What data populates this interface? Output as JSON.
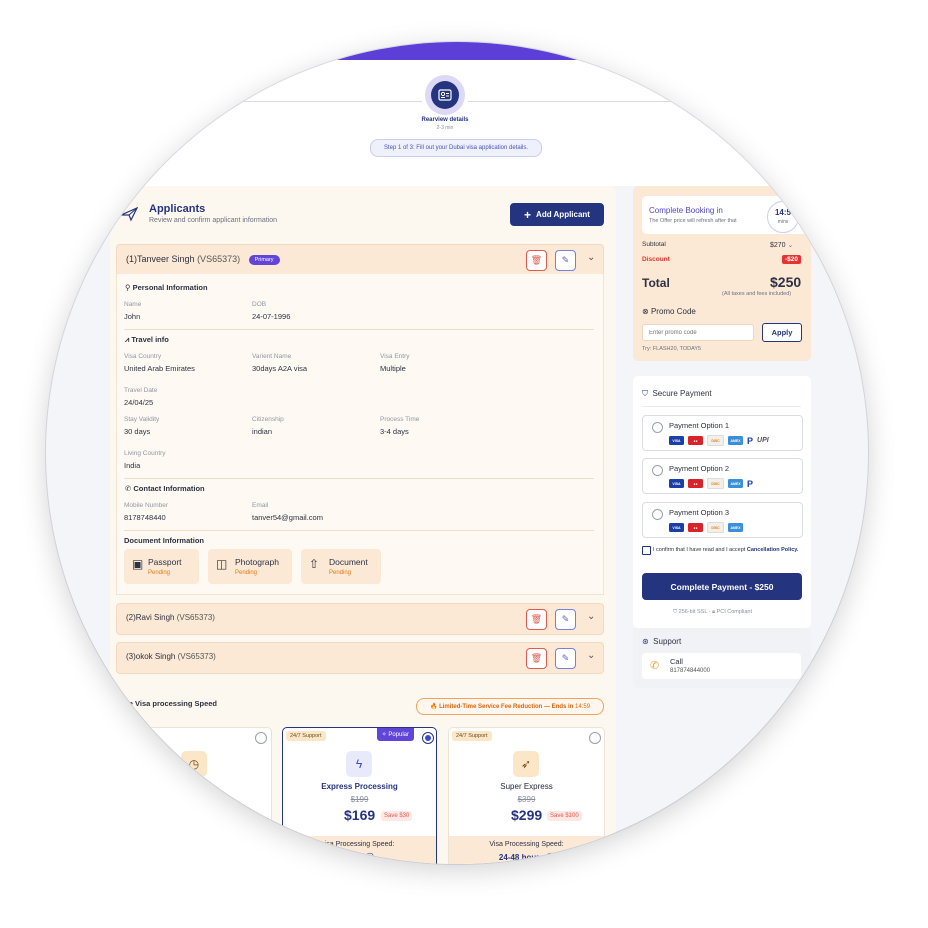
{
  "stepper": {
    "step_label": "Rearview details",
    "step_sub": "2-3 min",
    "hint": "Step 1 of 3: Fill out your Dubai visa application details."
  },
  "applicants": {
    "title": "Applicants",
    "subtitle": "Review and confirm applicant information",
    "add_label": "Add Applicant"
  },
  "applicant1": {
    "name": "(1)Tanveer Singh",
    "id": "(VS65373)",
    "badge": "Primary",
    "personal": {
      "title": "Personal Information",
      "name_label": "Name",
      "name": "John",
      "dob_label": "DOB",
      "dob": "24-07-1996"
    },
    "travel": {
      "title": "Travel info",
      "visa_country_label": "Visa Country",
      "visa_country": "United Arab Emirates",
      "variant_label": "Varient Name",
      "variant": "30days A2A visa",
      "entry_label": "Visa Entry",
      "entry": "Multiple",
      "travel_date_label": "Travel Date",
      "travel_date": "24/04/25",
      "stay_label": "Stay Validity",
      "stay": "30 days",
      "citizenship_label": "Citizenship",
      "citizenship": "indian",
      "process_label": "Process Time",
      "process": "3-4 days",
      "living_label": "Living Country",
      "living": "India"
    },
    "contact": {
      "title": "Contact Information",
      "mobile_label": "Mobile Number",
      "mobile": "8178748440",
      "email_label": "Email",
      "email": "tanver54@gmail.com"
    },
    "documents": {
      "title": "Document Information",
      "items": [
        {
          "name": "Passport",
          "status": "Pending"
        },
        {
          "name": "Photograph",
          "status": "Pending"
        },
        {
          "name": "Document",
          "status": "Pending"
        }
      ]
    }
  },
  "applicant2": {
    "name": "(2)Ravi Singh",
    "id": "(VS65373)"
  },
  "applicant3": {
    "name": "(3)okok Singh",
    "id": "(VS65373)"
  },
  "speed": {
    "title": "ose Visa processing Speed",
    "limited": "Limited-Time Service Fee Reduction — Ends in",
    "limited_time": "14:59",
    "cards": [
      {
        "tag": "",
        "name": "ssing",
        "old": "",
        "price": "",
        "save": "",
        "foot_label": "",
        "foot_value": ""
      },
      {
        "tag": "24/7 Support",
        "popular": "Popular",
        "name": "Express Processing",
        "old": "$199",
        "price": "$169",
        "save": "Save $30",
        "foot_label": "isa Processing Speed:",
        "foot_value": "days"
      },
      {
        "tag": "24/7 Support",
        "name": "Super Express",
        "old": "$399",
        "price": "$299",
        "save": "Save $100",
        "foot_label": "Visa Processing Speed:",
        "foot_value": "24-48 hours"
      }
    ]
  },
  "booking": {
    "title": "Complete Booking in",
    "sub": "The Offer price will refresh after that",
    "timer": "14:5",
    "timer_unit": "mins",
    "subtotal_label": "Subtotal",
    "subtotal": "$270",
    "discount_label": "Discount",
    "discount": "-$20",
    "total_label": "Total",
    "total": "$250",
    "total_note": "(All taxes and fees included)",
    "promo_label": "Promo Code",
    "promo_placeholder": "Enter promo code",
    "apply_label": "Apply",
    "promo_hint": "Try: FLASH20, TODAY5"
  },
  "payment": {
    "title": "Secure Payment",
    "options": [
      "Payment Option 1",
      "Payment Option 2",
      "Payment Option 3"
    ],
    "consent": "I confirm that I have read and I accept",
    "consent_link": "Cancellation Policy.",
    "complete_label": "Complete Payment - $250",
    "ssl": "256-bit SSL",
    "pci": "PCI Compliant",
    "upi": "UPI"
  },
  "support": {
    "title": "Support",
    "call_label": "Call",
    "call_number": "817874844000"
  },
  "colors": {
    "primary": "#25347f",
    "accent": "#6045d8",
    "warm_bg": "#fbe9d6",
    "danger": "#e3342f"
  }
}
